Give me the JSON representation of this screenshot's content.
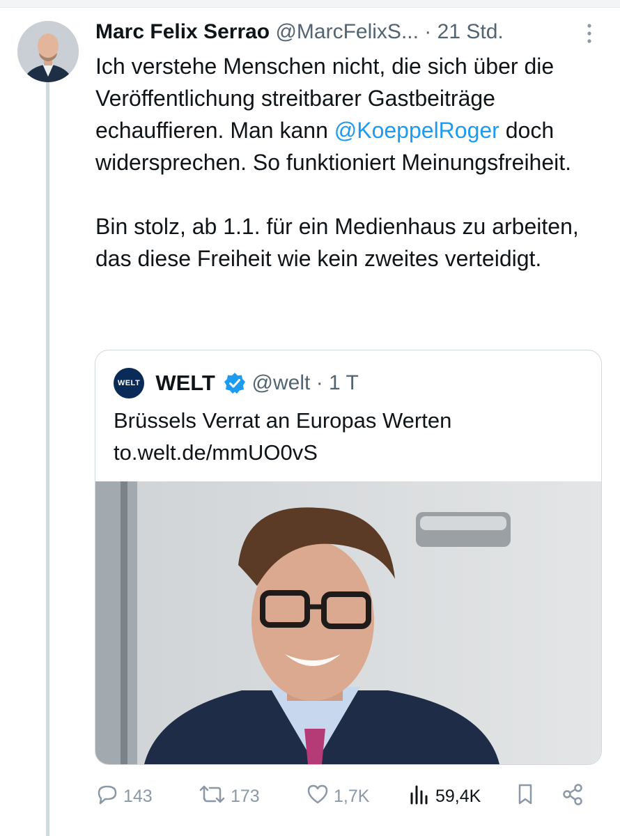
{
  "tweet": {
    "author_name": "Marc Felix Serrao",
    "author_handle": "@MarcFelixS...",
    "separator": "·",
    "time": "21 Std.",
    "text_part1": "Ich verstehe Menschen nicht, die sich über die Veröffentlichung streitbarer Gastbeiträge echauffieren. Man kann ",
    "mention": "@KoeppelRoger",
    "text_part2": " doch widersprechen. So funktioniert Meinungsfreiheit.\n\nBin stolz, ab 1.1. für ein Medienhaus zu arbeiten, das diese Freiheit wie kein zweites verteidigt."
  },
  "quote": {
    "logo_text": "WELT",
    "name": "WELT",
    "handle": "@welt",
    "separator": "·",
    "time": "1 T",
    "text": "Brüssels Verrat an Europas Werten\nto.welt.de/mmUO0vS"
  },
  "actions": {
    "replies": "143",
    "reposts": "173",
    "likes": "1,7K",
    "views": "59,4K"
  },
  "colors": {
    "mention": "#1d9bf0",
    "muted": "#536471",
    "verified": "#1d9bf0"
  },
  "icons": [
    "more-vertical-icon",
    "verified-badge-icon",
    "reply-icon",
    "repost-icon",
    "like-icon",
    "views-icon",
    "bookmark-icon",
    "share-icon"
  ]
}
